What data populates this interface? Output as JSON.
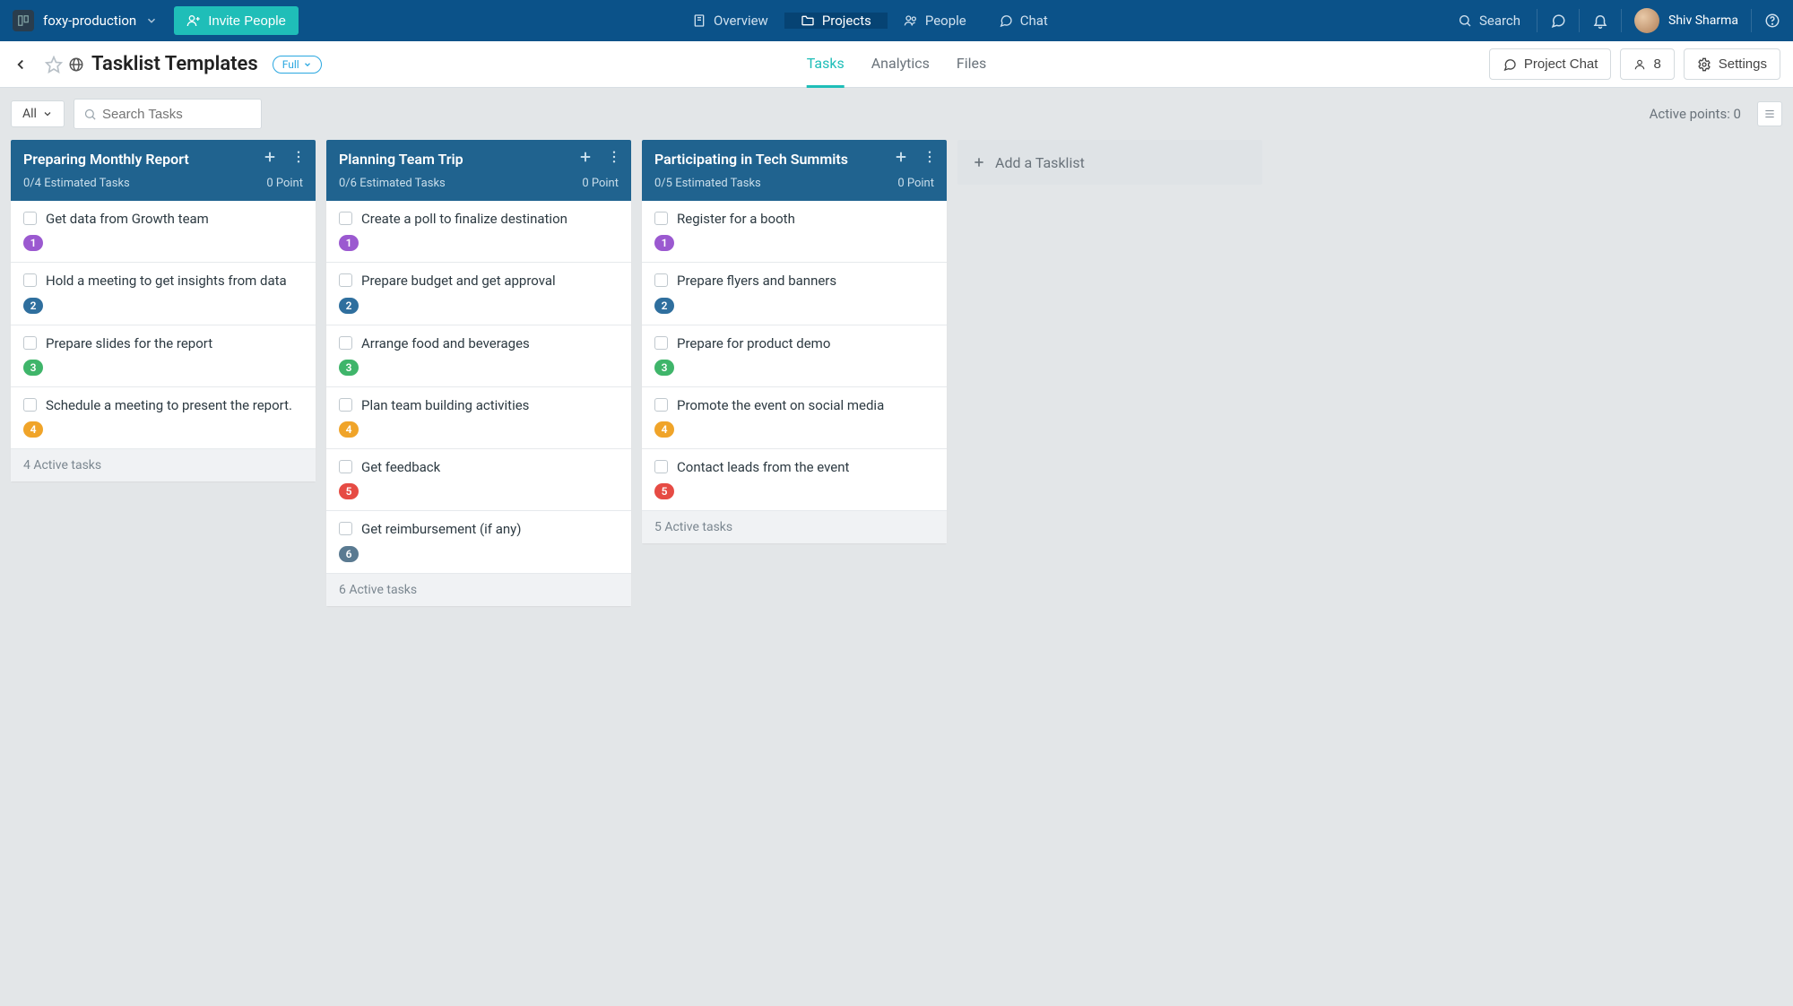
{
  "topnav": {
    "workspace": "foxy-production",
    "invite_label": "Invite People",
    "items": [
      {
        "label": "Overview",
        "icon": "notebook"
      },
      {
        "label": "Projects",
        "icon": "folder",
        "active": true
      },
      {
        "label": "People",
        "icon": "people"
      },
      {
        "label": "Chat",
        "icon": "chat"
      }
    ],
    "search_label": "Search",
    "user_name": "Shiv Sharma"
  },
  "project": {
    "title": "Tasklist Templates",
    "badge": "Full",
    "tabs": [
      {
        "label": "Tasks",
        "active": true
      },
      {
        "label": "Analytics"
      },
      {
        "label": "Files"
      }
    ],
    "chat_btn": "Project Chat",
    "people_count": "8",
    "settings_btn": "Settings"
  },
  "toolbar": {
    "filter": "All",
    "search_placeholder": "Search Tasks",
    "active_points": "Active points: 0"
  },
  "add_tasklist_label": "Add a Tasklist",
  "columns": [
    {
      "title": "Preparing Monthly Report",
      "estimate": "0/4 Estimated Tasks",
      "points": "0 Point",
      "footer": "4 Active tasks",
      "tasks": [
        {
          "name": "Get data from Growth team",
          "badge": "1",
          "color": "purple"
        },
        {
          "name": "Hold a meeting to get insights from data",
          "badge": "2",
          "color": "blue"
        },
        {
          "name": "Prepare slides for the report",
          "badge": "3",
          "color": "green"
        },
        {
          "name": "Schedule a meeting to present the report.",
          "badge": "4",
          "color": "orange"
        }
      ]
    },
    {
      "title": "Planning Team Trip",
      "estimate": "0/6 Estimated Tasks",
      "points": "0 Point",
      "footer": "6 Active tasks",
      "tasks": [
        {
          "name": "Create a poll to finalize destination",
          "badge": "1",
          "color": "purple"
        },
        {
          "name": "Prepare budget and get approval",
          "badge": "2",
          "color": "blue"
        },
        {
          "name": "Arrange food and beverages",
          "badge": "3",
          "color": "green"
        },
        {
          "name": "Plan team building activities",
          "badge": "4",
          "color": "orange"
        },
        {
          "name": "Get feedback",
          "badge": "5",
          "color": "red"
        },
        {
          "name": "Get reimbursement (if any)",
          "badge": "6",
          "color": "slate"
        }
      ]
    },
    {
      "title": "Participating in Tech Summits",
      "estimate": "0/5 Estimated Tasks",
      "points": "0 Point",
      "footer": "5 Active tasks",
      "tasks": [
        {
          "name": "Register for a booth",
          "badge": "1",
          "color": "purple"
        },
        {
          "name": "Prepare flyers and banners",
          "badge": "2",
          "color": "blue"
        },
        {
          "name": "Prepare for product demo",
          "badge": "3",
          "color": "green"
        },
        {
          "name": "Promote the event on social media",
          "badge": "4",
          "color": "orange"
        },
        {
          "name": "Contact leads from the event",
          "badge": "5",
          "color": "red"
        }
      ]
    }
  ],
  "badge_colors": {
    "purple": "b-purple",
    "blue": "b-blue",
    "green": "b-green",
    "orange": "b-orange",
    "red": "b-red",
    "slate": "b-slate"
  }
}
